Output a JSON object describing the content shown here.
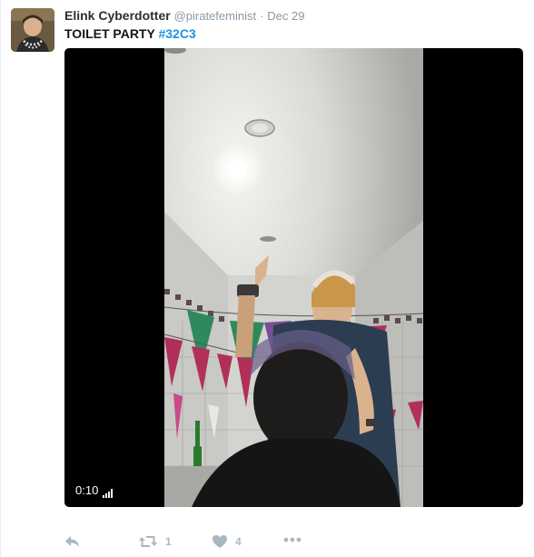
{
  "tweet": {
    "display_name": "Elink Cyberdotter",
    "screen_name": "@piratefeminist",
    "separator": "·",
    "date": "Dec 29",
    "text_prefix": "TOILET PARTY ",
    "hashtag": "#32C3"
  },
  "video": {
    "elapsed": "0:10"
  },
  "actions": {
    "retweet_count": "1",
    "like_count": "4"
  },
  "icons": {
    "reply": "reply-icon",
    "retweet": "retweet-icon",
    "like": "heart-icon",
    "more": "more-icon",
    "signal": "signal-bars-icon"
  },
  "colors": {
    "link": "#1b95e0",
    "muted": "#8899a6",
    "action_icon": "#aab8c2"
  }
}
